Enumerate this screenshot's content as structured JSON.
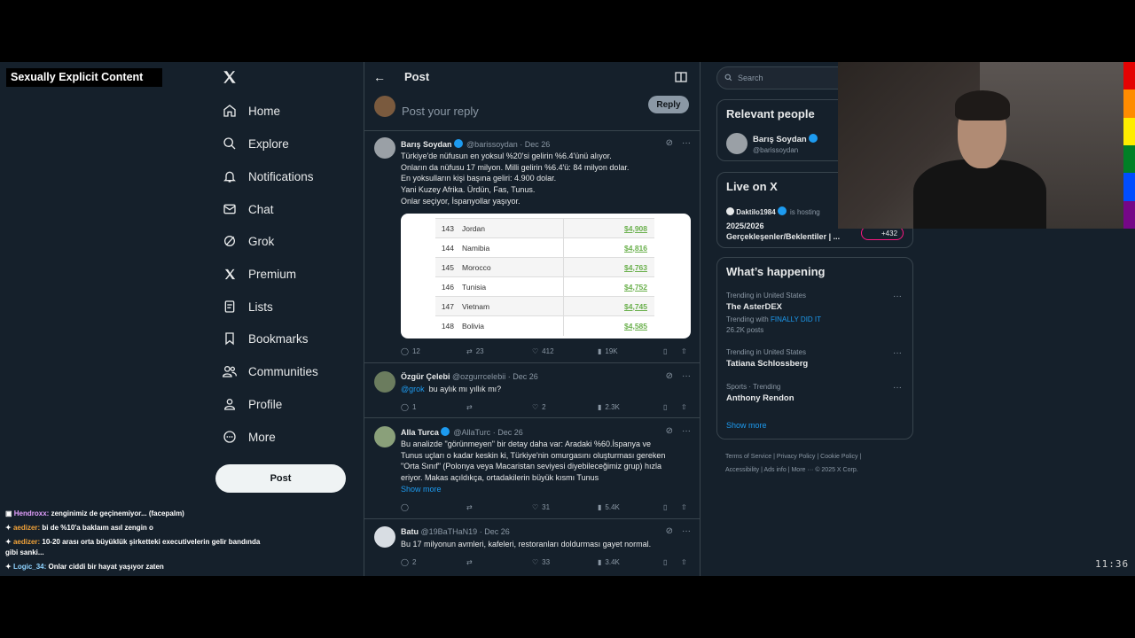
{
  "overlay": {
    "label": "Sexually Explicit Content",
    "clock": "11:36"
  },
  "nav": {
    "items": [
      {
        "label": "Home",
        "icon": "home-icon"
      },
      {
        "label": "Explore",
        "icon": "search-icon"
      },
      {
        "label": "Notifications",
        "icon": "bell-icon"
      },
      {
        "label": "Chat",
        "icon": "mail-icon"
      },
      {
        "label": "Grok",
        "icon": "grok-icon"
      },
      {
        "label": "Premium",
        "icon": "x-logo-icon"
      },
      {
        "label": "Lists",
        "icon": "list-icon"
      },
      {
        "label": "Bookmarks",
        "icon": "bookmark-icon"
      },
      {
        "label": "Communities",
        "icon": "people-icon"
      },
      {
        "label": "Profile",
        "icon": "person-icon"
      },
      {
        "label": "More",
        "icon": "more-circle-icon"
      }
    ],
    "post_label": "Post"
  },
  "main": {
    "title": "Post",
    "reply_placeholder": "Post your reply",
    "reply_button": "Reply",
    "tweets": [
      {
        "name": "Barış Soydan",
        "handle": "@barissoydan",
        "date": "· Dec 26",
        "lines": [
          "Türkiye'de nüfusun en yoksul %20'si gelirin %6.4'ünü alıyor.",
          "Onların da nüfusu 17 milyon.  Milli gelirin %6.4'ü: 84 milyon dolar.",
          "En yoksulların kişi başına geliri: 4.900 dolar.",
          "Yani Kuzey Afrika. Ürdün, Fas, Tunus.",
          "Onlar seçiyor, İspanyollar yaşıyor."
        ],
        "table": [
          {
            "rank": "143",
            "country": "Jordan",
            "value": "$4,908"
          },
          {
            "rank": "144",
            "country": "Namibia",
            "value": "$4,816"
          },
          {
            "rank": "145",
            "country": "Morocco",
            "value": "$4,763"
          },
          {
            "rank": "146",
            "country": "Tunisia",
            "value": "$4,752"
          },
          {
            "rank": "147",
            "country": "Vietnam",
            "value": "$4,745"
          },
          {
            "rank": "148",
            "country": "Bolivia",
            "value": "$4,585"
          }
        ],
        "replies": "12",
        "reposts": "23",
        "likes": "412",
        "views": "19K"
      },
      {
        "name": "Özgür Çelebi",
        "handle": "@ozgurrcelebii",
        "date": "· Dec 26",
        "mention": "@grok",
        "text": "bu aylık mı yıllık mı?",
        "replies": "1",
        "reposts": "",
        "likes": "2",
        "views": "2.3K"
      },
      {
        "name": "Alla Turca",
        "handle": "@AllaTurc",
        "date": "· Dec 26",
        "lines": [
          "Bu analizde \"görünmeyen\" bir detay daha var: Aradaki %60.İspanya ve",
          "Tunus uçları o kadar keskin ki, Türkiye'nin omurgasını oluşturması gereken",
          "\"Orta Sınıf\" (Polonya veya Macaristan seviyesi diyebileceğimiz grup) hızla",
          "eriyor. Makas açıldıkça, ortadakilerin büyük kısmı Tunus"
        ],
        "show_more": "Show more",
        "replies": "",
        "reposts": "",
        "likes": "31",
        "views": "5.4K"
      },
      {
        "name": "Batu",
        "handle": "@19BaTHaN19",
        "date": "· Dec 26",
        "text": "Bu 17 milyonun avmleri, kafeleri, restoranları doldurması gayet normal.",
        "replies": "2",
        "reposts": "",
        "likes": "33",
        "views": "3.4K"
      }
    ]
  },
  "right": {
    "search_placeholder": "Search",
    "relevant": {
      "title": "Relevant people",
      "name": "Barış Soydan",
      "handle": "@barissoydan"
    },
    "live": {
      "title": "Live on X",
      "host": "Daktilo1984",
      "hosting": "is hosting",
      "topic": "2025/2026",
      "topic2": "Gerçekleşenler/Beklentiler | ...",
      "count": "+432"
    },
    "happening": {
      "title": "What’s happening",
      "trends": [
        {
          "meta": "Trending in United States",
          "name": "The AsterDEX",
          "with_label": "Trending with",
          "with_link": "FINALLY DID IT",
          "posts": "26.2K posts"
        },
        {
          "meta": "Trending in United States",
          "name": "Tatiana Schlossberg"
        },
        {
          "meta": "Sports · Trending",
          "name": "Anthony Rendon"
        }
      ],
      "show_more": "Show more"
    },
    "footer": {
      "line1": [
        "Terms of Service",
        "Privacy Policy",
        "Cookie Policy"
      ],
      "line2": [
        "Accessibility",
        "Ads info",
        "More ···",
        "© 2025 X Corp."
      ]
    }
  },
  "chat": [
    {
      "user": "Hendroxx:",
      "msg": "zenginimiz de geçinemiyor... (facepalm)"
    },
    {
      "user": "aedizer:",
      "msg": "bi de %10'a baklaım asıl zengin o"
    },
    {
      "user": "aedizer:",
      "msg": "10-20 arası orta büyüklük şirketteki executivelerin gelir bandında gibi sanki..."
    },
    {
      "user": "Logic_34:",
      "msg": "Onlar ciddi bir hayat yaşıyor zaten"
    }
  ],
  "colors": {
    "bg": "#15202b",
    "accent": "#1d9bf0",
    "border": "#38444d",
    "muted": "#8b98a5",
    "table_value": "#6ab04c"
  }
}
